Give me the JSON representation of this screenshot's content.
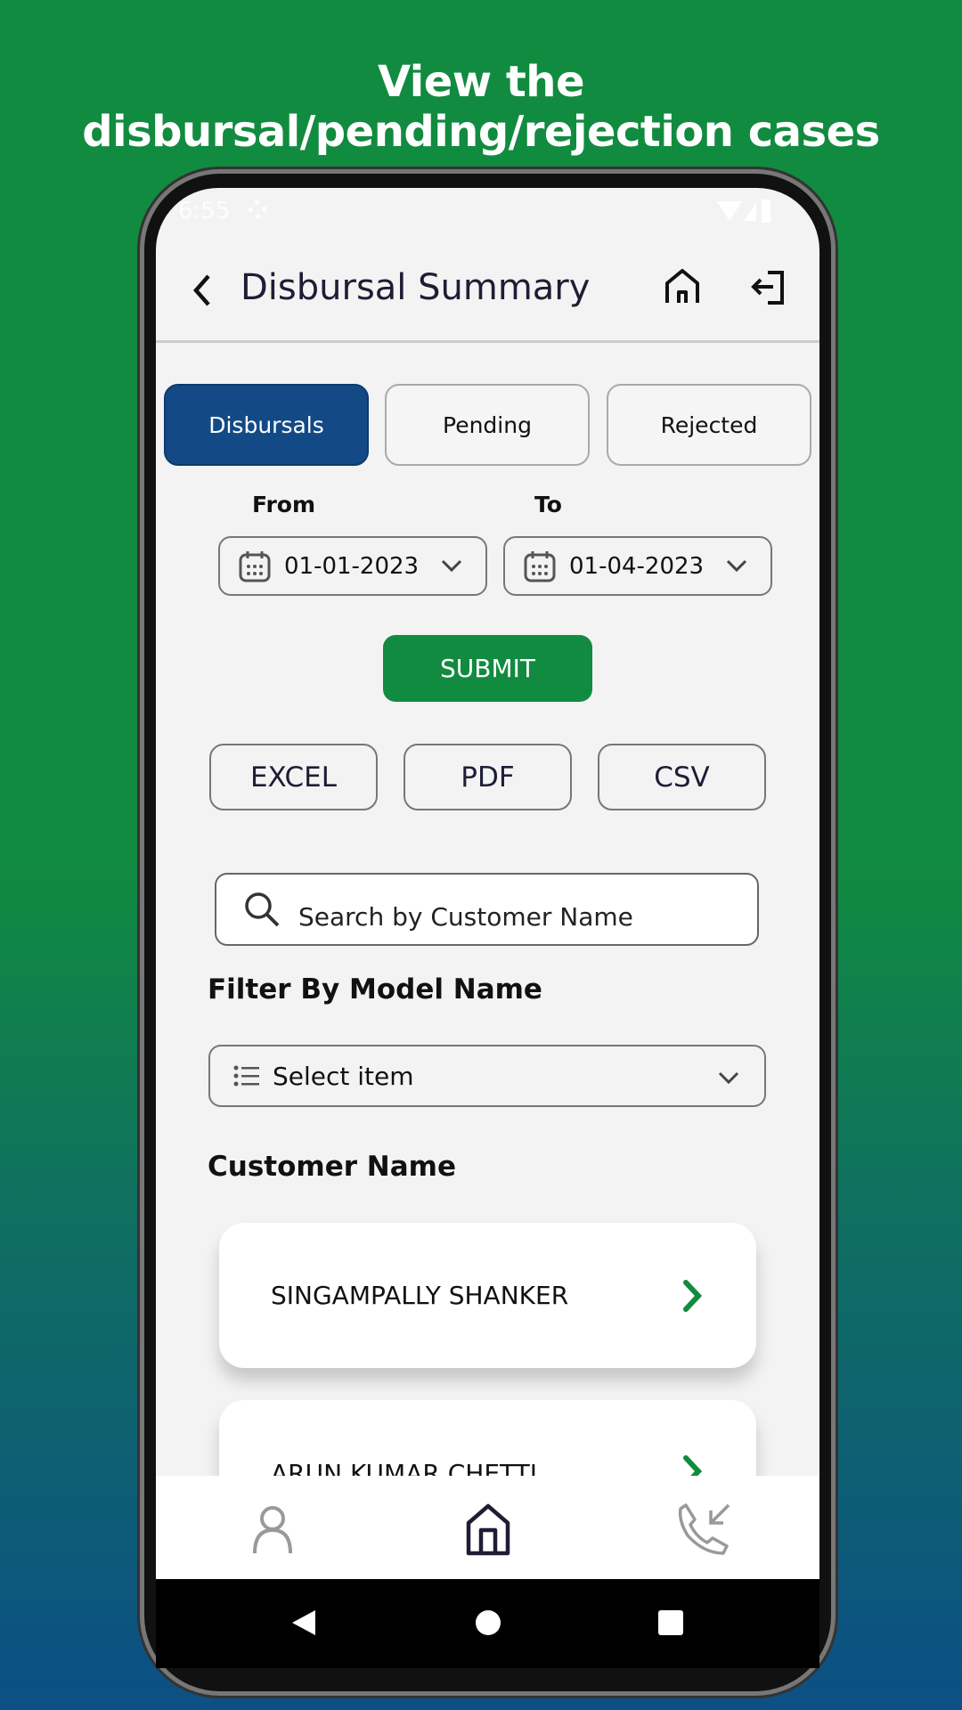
{
  "headline": {
    "line1": "View the",
    "line2": "disbursal/pending/rejection cases"
  },
  "status": {
    "time": "6:55"
  },
  "header": {
    "title": "Disbursal Summary"
  },
  "tabs": [
    {
      "label": "Disbursals",
      "active": true
    },
    {
      "label": "Pending",
      "active": false
    },
    {
      "label": "Rejected",
      "active": false
    }
  ],
  "dates": {
    "from_label": "From",
    "to_label": "To",
    "from_value": "01-01-2023",
    "to_value": "01-04-2023"
  },
  "submit_label": "SUBMIT",
  "exports": [
    "EXCEL",
    "PDF",
    "CSV"
  ],
  "search": {
    "placeholder": "Search by Customer Name"
  },
  "filter": {
    "label": "Filter By Model Name",
    "placeholder": "Select item"
  },
  "list": {
    "label": "Customer Name",
    "items": [
      "SINGAMPALLY  SHANKER",
      "ARUN KUMAR  CHETTI"
    ]
  },
  "colors": {
    "primary_green": "#118b3f",
    "tab_active": "#134a86"
  }
}
